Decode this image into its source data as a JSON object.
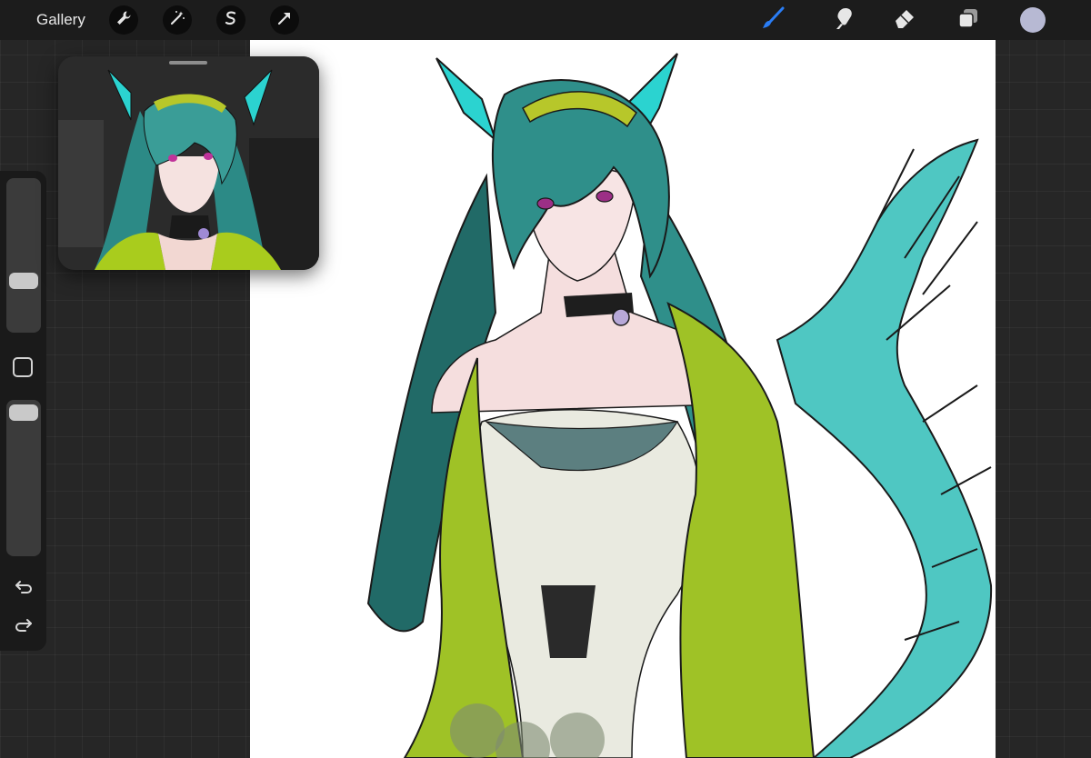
{
  "app": {
    "gallery_label": "Gallery"
  },
  "toolbar": {
    "left_tools": [
      "wrench-icon",
      "magic-wand-icon",
      "selection-icon",
      "transform-arrow-icon"
    ],
    "right_tools": [
      "brush-icon",
      "smudge-icon",
      "eraser-icon",
      "layers-icon"
    ],
    "active_tool": "brush",
    "accent_color": "#2a7df5",
    "current_color": "#b7b9d3"
  },
  "sidebar": {
    "brush_size_level": 0.55,
    "opacity_level": 0.92
  },
  "colors": {
    "hair": "#2f8f8a",
    "hair_dark": "#216a67",
    "fins": "#2bd3d0",
    "jacket": "#9fc226",
    "dress": "#e9eae0",
    "skin": "#f5dede"
  }
}
